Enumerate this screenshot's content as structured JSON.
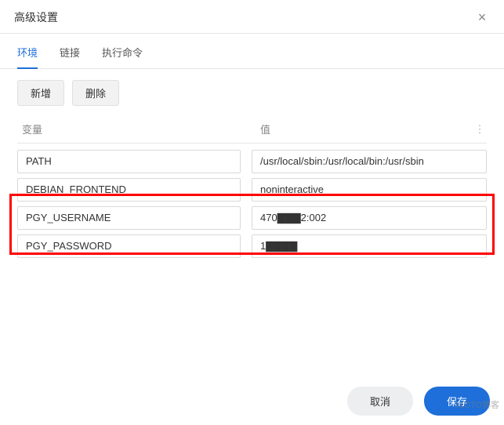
{
  "dialog": {
    "title": "高级设置",
    "close": "×"
  },
  "tabs": {
    "env": "环境",
    "link": "链接",
    "exec": "执行命令"
  },
  "toolbar": {
    "add": "新增",
    "delete": "删除"
  },
  "columns": {
    "variable": "变量",
    "value": "值",
    "more": "⋮"
  },
  "rows": [
    {
      "variable": "PATH",
      "value": "/usr/local/sbin:/usr/local/bin:/usr/sbin"
    },
    {
      "variable": "DEBIAN_FRONTEND",
      "value": "noninteractive"
    },
    {
      "variable": "PGY_USERNAME",
      "value": "470▇▇▇2:002"
    },
    {
      "variable": "PGY_PASSWORD",
      "value": "1▇▇▇▇"
    }
  ],
  "footer": {
    "cancel": "取消",
    "save": "保存"
  },
  "watermark": "51CTO博客"
}
